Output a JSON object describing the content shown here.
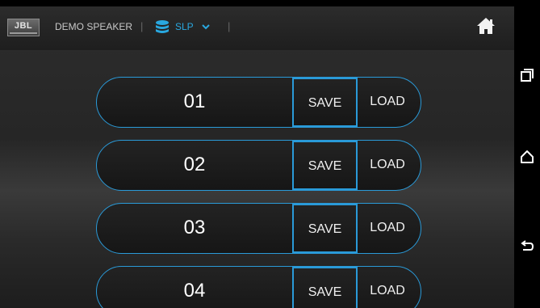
{
  "header": {
    "logo_text": "JBL",
    "device_name": "DEMO SPEAKER",
    "separator": "|",
    "preset_selector": "SLP",
    "icons": [
      "database-icon",
      "chevron-down-icon",
      "home-icon"
    ]
  },
  "presets": [
    {
      "number": "01",
      "save_label": "SAVE",
      "load_label": "LOAD"
    },
    {
      "number": "02",
      "save_label": "SAVE",
      "load_label": "LOAD"
    },
    {
      "number": "03",
      "save_label": "SAVE",
      "load_label": "LOAD"
    },
    {
      "number": "04",
      "save_label": "SAVE",
      "load_label": "LOAD"
    }
  ],
  "system_nav": {
    "buttons": [
      "recent-apps-icon",
      "home-nav-icon",
      "back-icon"
    ]
  },
  "colors": {
    "accent": "#2a9ad8",
    "selector_text": "#29a8e0",
    "background": "#262626",
    "text": "#ffffff"
  }
}
